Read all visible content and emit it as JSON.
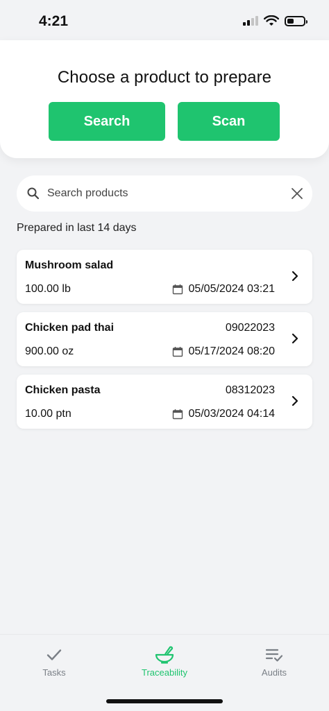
{
  "status_bar": {
    "time": "4:21"
  },
  "header": {
    "title": "Choose a product to prepare",
    "search_label": "Search",
    "scan_label": "Scan"
  },
  "search": {
    "placeholder": "Search products",
    "value": ""
  },
  "section_label": "Prepared in last 14 days",
  "products": [
    {
      "name": "Mushroom salad",
      "code": "",
      "quantity": "100.00 lb",
      "datetime": "05/05/2024 03:21"
    },
    {
      "name": "Chicken pad thai",
      "code": "09022023",
      "quantity": "900.00 oz",
      "datetime": "05/17/2024 08:20"
    },
    {
      "name": "Chicken pasta",
      "code": "08312023",
      "quantity": "10.00 ptn",
      "datetime": "05/03/2024 04:14"
    }
  ],
  "tabs": [
    {
      "label": "Tasks",
      "icon": "checkmark-icon",
      "active": false
    },
    {
      "label": "Traceability",
      "icon": "mortar-pestle-icon",
      "active": true
    },
    {
      "label": "Audits",
      "icon": "list-check-icon",
      "active": false
    }
  ],
  "colors": {
    "accent": "#1fc46f",
    "background": "#f2f3f5",
    "inactive_tab": "#7a7f86"
  }
}
